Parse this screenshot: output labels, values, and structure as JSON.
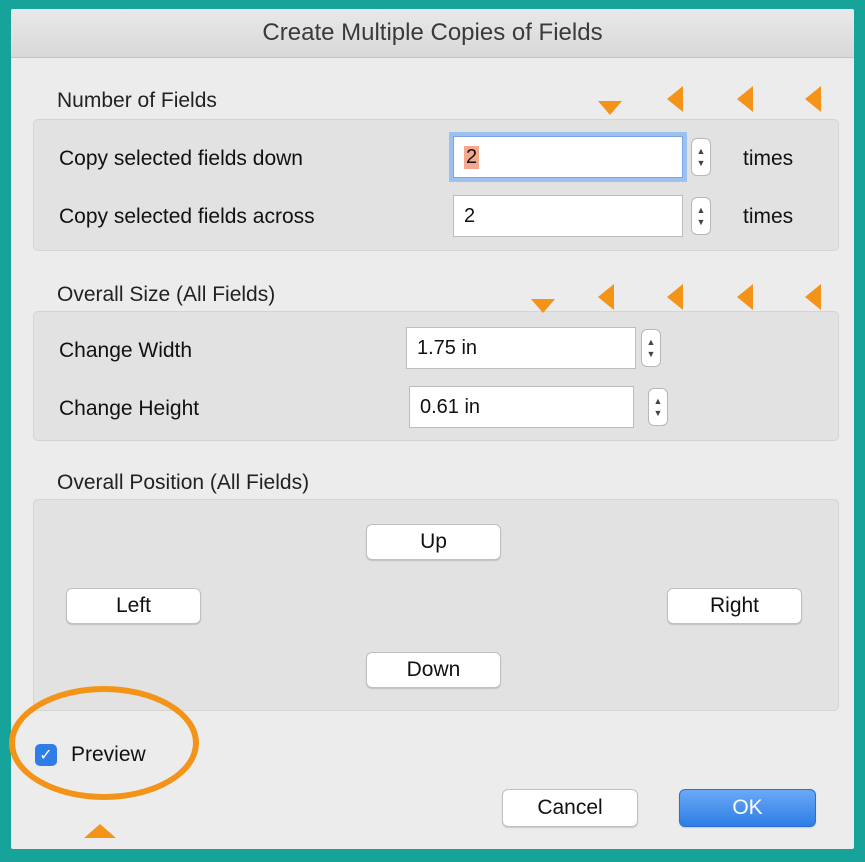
{
  "dialog": {
    "title": "Create Multiple Copies of Fields"
  },
  "number_of_fields": {
    "section_label": "Number of Fields",
    "down_label": "Copy selected fields down",
    "down_value": "2",
    "down_unit": "times",
    "across_label": "Copy selected fields across",
    "across_value": "2",
    "across_unit": "times"
  },
  "overall_size": {
    "section_label": "Overall Size (All Fields)",
    "width_label": "Change Width",
    "width_value": "1.75 in",
    "height_label": "Change Height",
    "height_value": "0.61 in"
  },
  "overall_position": {
    "section_label": "Overall Position (All Fields)",
    "up_label": "Up",
    "left_label": "Left",
    "right_label": "Right",
    "down_label": "Down"
  },
  "preview": {
    "label": "Preview",
    "checked": true
  },
  "footer": {
    "cancel_label": "Cancel",
    "ok_label": "OK"
  },
  "colors": {
    "background": "#16a39a",
    "annotation": "#f39419",
    "accent": "#2f7ee8"
  },
  "icons": {
    "stepper": "stepper-icon",
    "checkbox": "checkmark-icon",
    "annotation_down": "arrow-down-marker-icon",
    "annotation_left": "arrow-left-marker-icon",
    "annotation_up": "arrow-up-marker-icon"
  }
}
